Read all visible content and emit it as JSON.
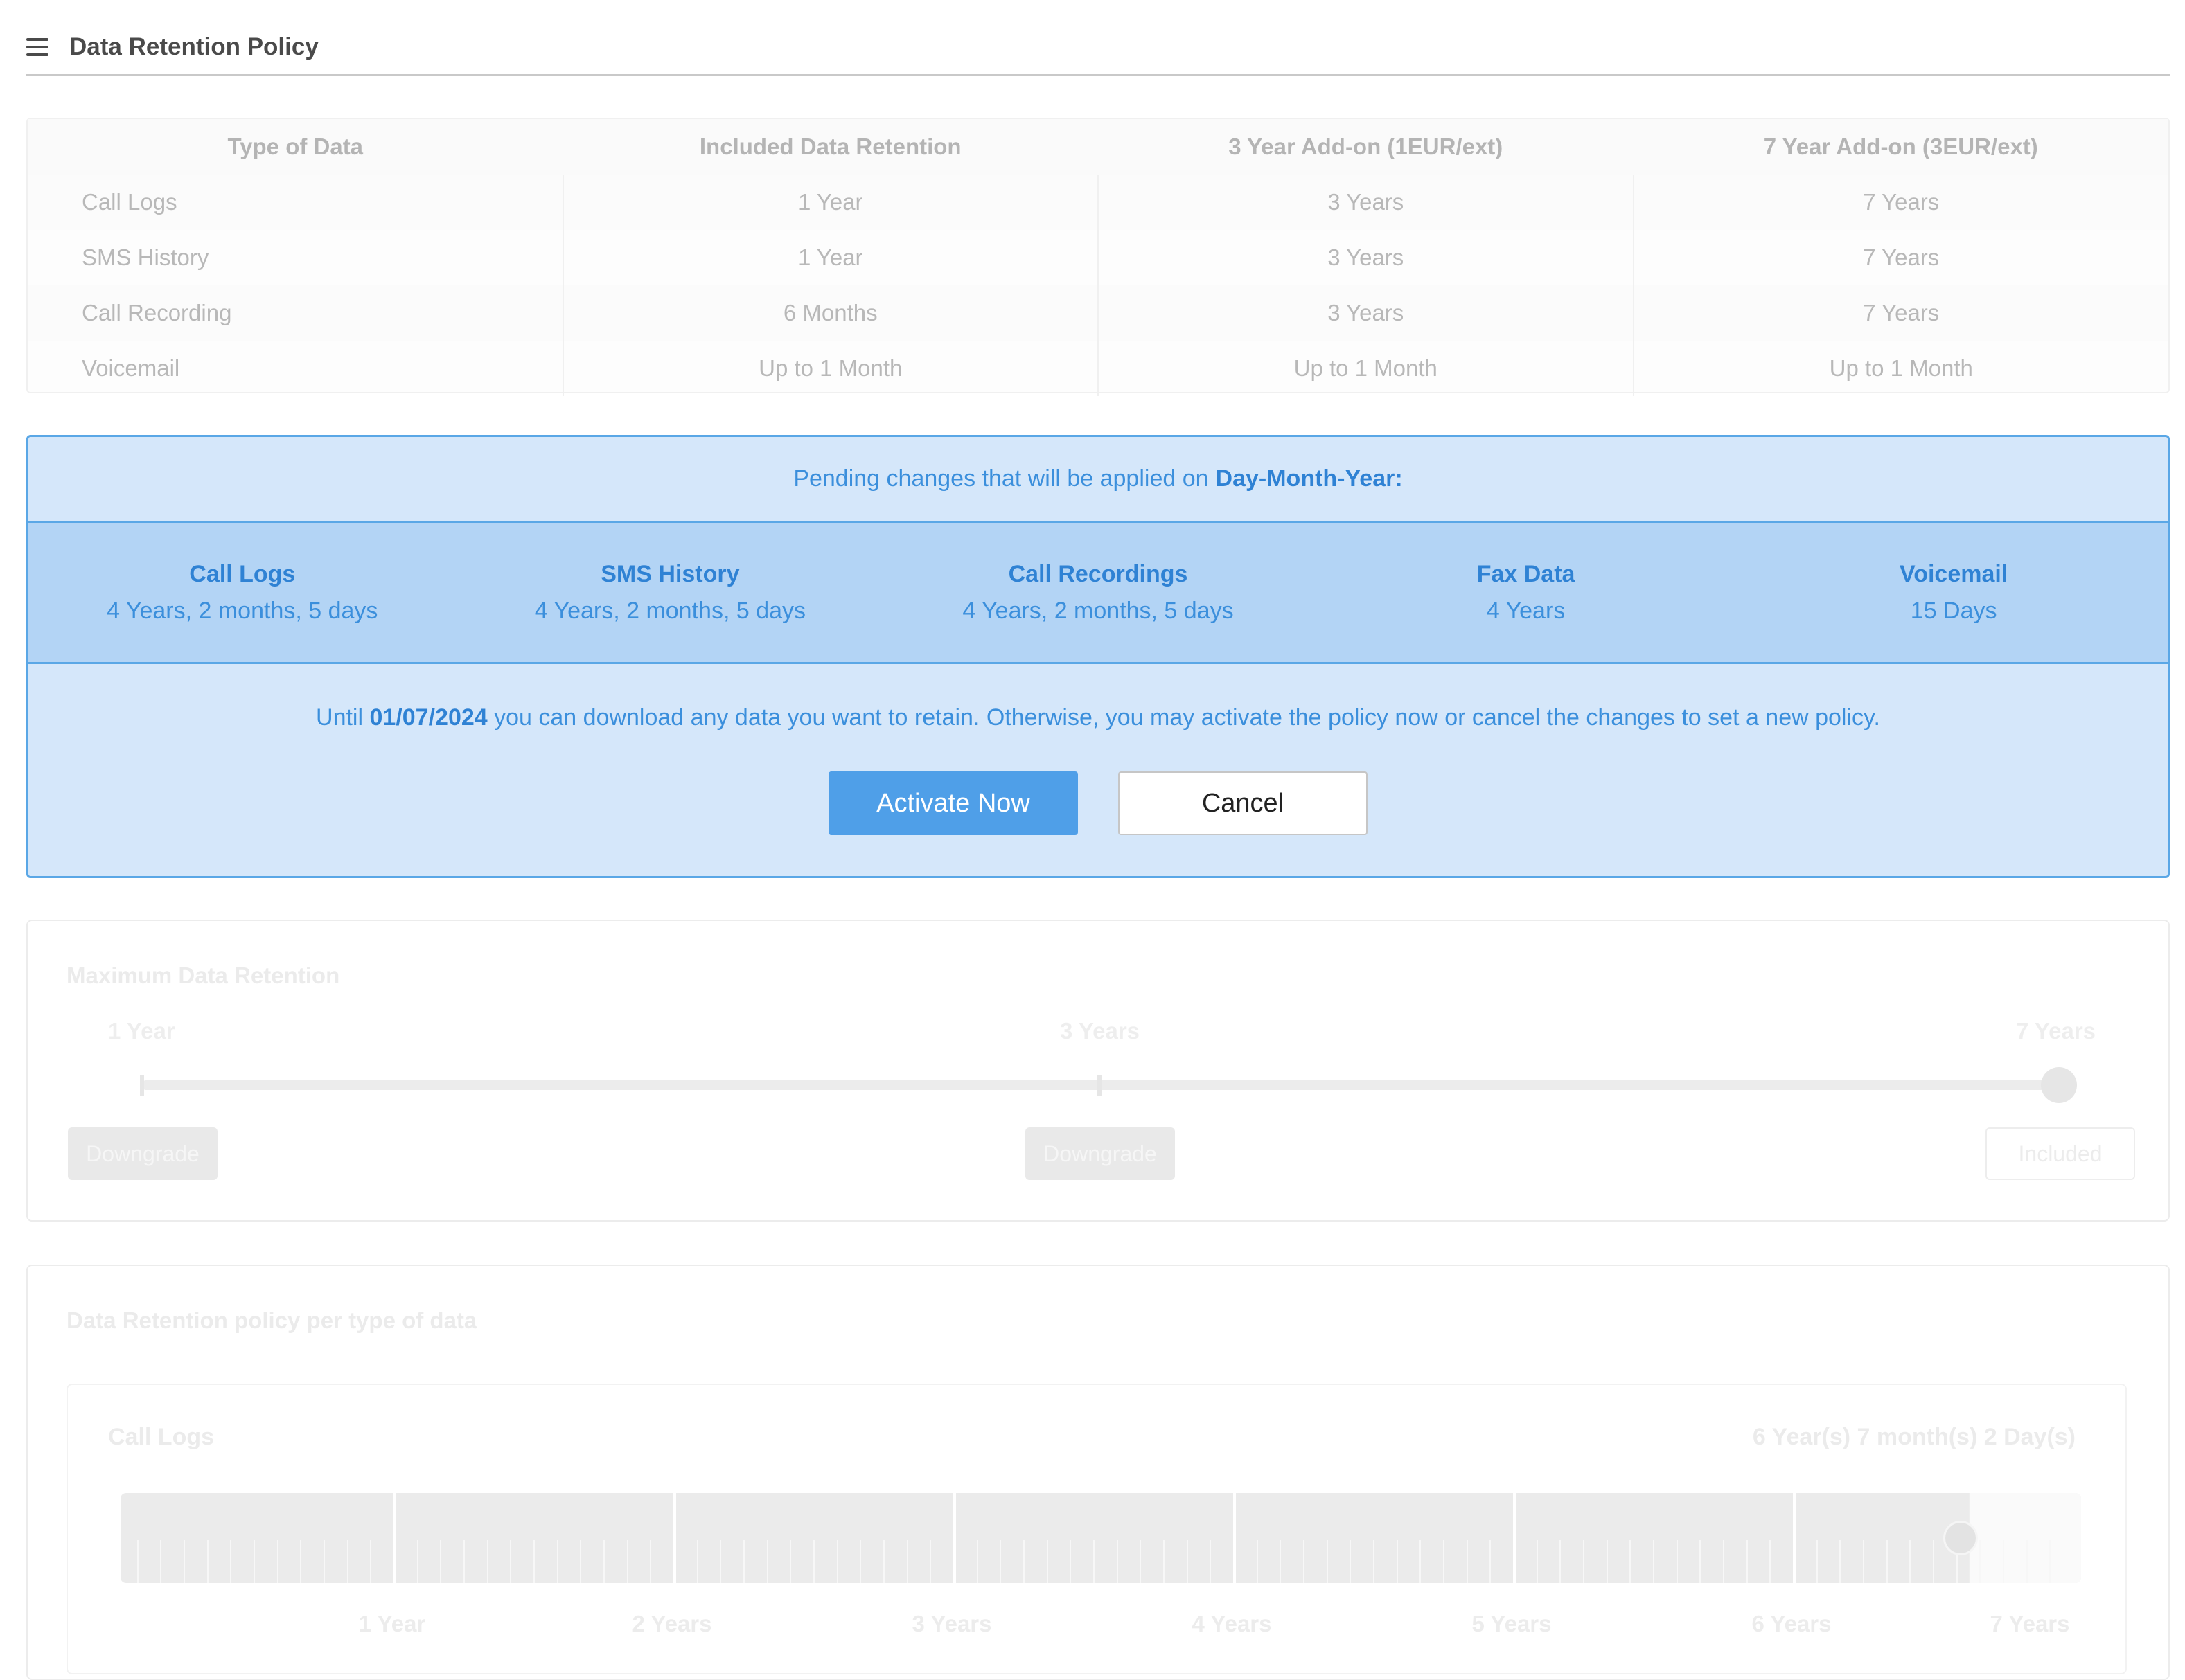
{
  "header": {
    "title": "Data Retention Policy"
  },
  "summary": {
    "columns": [
      "Type of Data",
      "Included Data Retention",
      "3 Year Add-on (1EUR/ext)",
      "7 Year Add-on (3EUR/ext)"
    ],
    "rows": [
      [
        "Call Logs",
        "1 Year",
        "3 Years",
        "7 Years"
      ],
      [
        "SMS History",
        "1 Year",
        "3 Years",
        "7 Years"
      ],
      [
        "Call Recording",
        "6 Months",
        "3 Years",
        "7 Years"
      ],
      [
        "Voicemail",
        "Up to 1 Month",
        "Up to 1 Month",
        "Up to 1 Month"
      ]
    ]
  },
  "pending": {
    "header_text": "Pending changes that will be applied on",
    "header_date": "Day-Month-Year:",
    "items": [
      {
        "label": "Call Logs",
        "value": "4 Years, 2 months, 5 days"
      },
      {
        "label": "SMS History",
        "value": "4 Years, 2 months, 5 days"
      },
      {
        "label": "Call Recordings",
        "value": "4 Years, 2 months, 5 days"
      },
      {
        "label": "Fax Data",
        "value": "4 Years"
      },
      {
        "label": "Voicemail",
        "value": "15 Days"
      }
    ],
    "note_prefix": "Until",
    "note_date": "01/07/2024",
    "note_suffix": "you can download any data you want to retain. Otherwise, you may activate the policy now or cancel the changes to set a new policy.",
    "activate_label": "Activate Now",
    "cancel_label": "Cancel"
  },
  "max_retention": {
    "title": "Maximum Data Retention",
    "levels": [
      "1 Year",
      "3 Years",
      "7 Years"
    ],
    "selected_level": "7 Years",
    "buttons": [
      "Downgrade",
      "Downgrade",
      "Included"
    ]
  },
  "per_type": {
    "title": "Data Retention policy per type of data",
    "call_logs": {
      "label": "Call Logs",
      "value": "6 Year(s) 7 month(s) 2 Day(s)",
      "axis_labels": [
        "1 Year",
        "2 Years",
        "3 Years",
        "4 Years",
        "5 Years",
        "6 Years",
        "7 Years"
      ],
      "selected_years": 6.6
    }
  },
  "colors": {
    "accent": "#4f9fe8",
    "pending_bg": "#d5e7fa",
    "pending_items_bg": "#b3d4f5",
    "pending_border": "#5aa7e6"
  }
}
